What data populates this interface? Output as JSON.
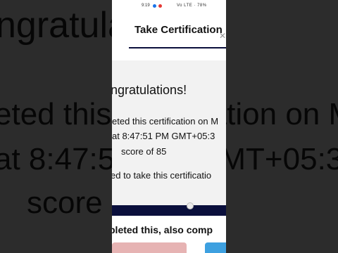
{
  "status_bar": {
    "time": "9:19",
    "right": "Vo LTE · 78%"
  },
  "header": {
    "title": "Take Certification"
  },
  "message": {
    "congrats": "ngratulations!",
    "line1": "eted this certification on M",
    "line2": "at 8:47:51 PM GMT+05:3",
    "line3": "score of 85",
    "line4": "ed to take this certificatio"
  },
  "also": {
    "text": "pleted this, also comp"
  },
  "background": {
    "title_left": "ngratulations!",
    "line1": "eted this certification on M",
    "line2": "at 8:47:51 PM GMT+05:3",
    "line3": "score of 85"
  },
  "colors": {
    "accent": "#0a0f3c",
    "screen_bg": "#ffffff",
    "card_bg": "#f2f2f2"
  }
}
